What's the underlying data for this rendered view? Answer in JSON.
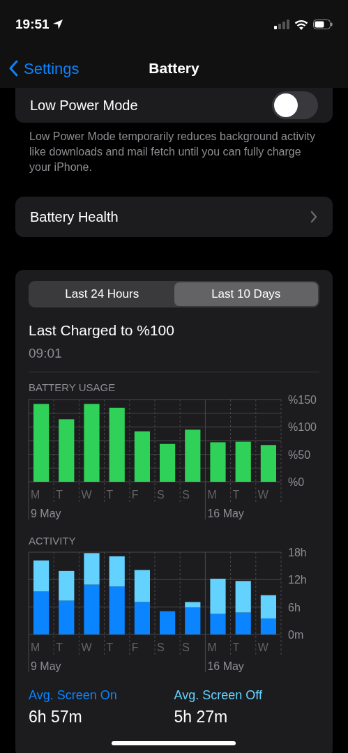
{
  "status_bar": {
    "time": "19:51"
  },
  "nav": {
    "back": "Settings",
    "title": "Battery"
  },
  "low_power": {
    "label": "Low Power Mode",
    "on": false,
    "footer": "Low Power Mode temporarily reduces background activity like downloads and mail fetch until you can fully charge your iPhone."
  },
  "battery_health": {
    "label": "Battery Health"
  },
  "segments": [
    {
      "label": "Last 24 Hours",
      "selected": false
    },
    {
      "label": "Last 10 Days",
      "selected": true
    }
  ],
  "last_charged": {
    "title": "Last Charged to %100",
    "time": "09:01"
  },
  "battery_usage": {
    "weeks": [
      {
        "date": "9 May",
        "days": [
          "M",
          "T",
          "W",
          "T",
          "F",
          "S",
          "S"
        ]
      },
      {
        "date": "16 May",
        "days": [
          "M",
          "T",
          "W"
        ]
      }
    ],
    "chart_data": {
      "type": "bar",
      "title": "BATTERY USAGE",
      "series": [
        {
          "color": "#30d158",
          "values": [
            142,
            114,
            142,
            135,
            92,
            69,
            95,
            72,
            73,
            67
          ]
        }
      ],
      "ylim": [
        0,
        150
      ],
      "yticks": [
        {
          "value": 0,
          "label": "%0"
        },
        {
          "value": 50,
          "label": "%50"
        },
        {
          "value": 100,
          "label": "%100"
        },
        {
          "value": 150,
          "label": "%150"
        }
      ]
    }
  },
  "activity": {
    "weeks": [
      {
        "date": "9 May",
        "days": [
          "M",
          "T",
          "W",
          "T",
          "F",
          "S",
          "S"
        ]
      },
      {
        "date": "16 May",
        "days": [
          "M",
          "T",
          "W"
        ]
      }
    ],
    "chart_data": {
      "type": "bar",
      "title": "ACTIVITY",
      "stacked": true,
      "series": [
        {
          "color": "#0a84ff",
          "values": [
            9.4,
            7.4,
            10.9,
            10.5,
            7.1,
            5.1,
            5.9,
            4.5,
            4.8,
            3.5
          ]
        },
        {
          "color": "#64d2ff",
          "values": [
            6.8,
            6.5,
            6.9,
            6.6,
            7.0,
            0,
            1.2,
            7.7,
            6.9,
            5.1
          ]
        }
      ],
      "ylim": [
        0,
        18
      ],
      "yticks": [
        {
          "value": 0,
          "label": "0m"
        },
        {
          "value": 6,
          "label": "6h"
        },
        {
          "value": 12,
          "label": "12h"
        },
        {
          "value": 18,
          "label": "18h"
        }
      ]
    }
  },
  "averages": [
    {
      "label": "Avg. Screen On",
      "value": "6h 57m",
      "color": "#0a84ff"
    },
    {
      "label": "Avg. Screen Off",
      "value": "5h 27m",
      "color": "#64d2ff"
    }
  ]
}
